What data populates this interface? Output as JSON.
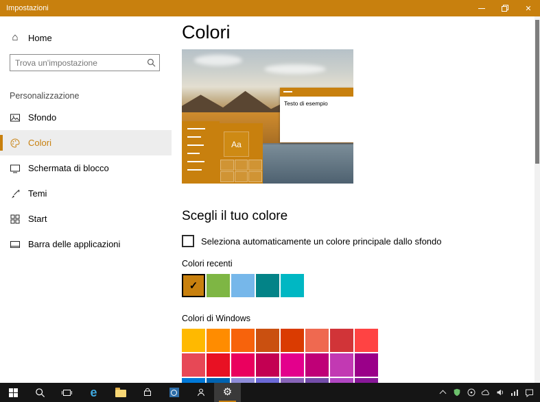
{
  "colors": {
    "accent": "#C8800E",
    "taskbar_bg": "#151515",
    "sidebar_selected_bg": "#EDEDED"
  },
  "window": {
    "title": "Impostazioni"
  },
  "icons": {
    "close": "✕",
    "check": "✓",
    "home": "⌂",
    "gear": "⚙",
    "edge": "e"
  },
  "sidebar": {
    "home": {
      "label": "Home",
      "icon": "home-icon"
    },
    "search": {
      "placeholder": "Trova un'impostazione",
      "icon": "search-icon"
    },
    "section": "Personalizzazione",
    "items": [
      {
        "label": "Sfondo",
        "icon": "background-icon",
        "selected": false
      },
      {
        "label": "Colori",
        "icon": "palette-icon",
        "selected": true
      },
      {
        "label": "Schermata di blocco",
        "icon": "lock-screen-icon",
        "selected": false
      },
      {
        "label": "Temi",
        "icon": "themes-icon",
        "selected": false
      },
      {
        "label": "Start",
        "icon": "start-grid-icon",
        "selected": false
      },
      {
        "label": "Barra delle applicazioni",
        "icon": "taskbar-icon",
        "selected": false
      }
    ]
  },
  "main": {
    "title": "Colori",
    "preview": {
      "tile_label": "Aa",
      "sample_window_text": "Testo di esempio"
    },
    "section_heading": "Scegli il tuo colore",
    "auto_color_checkbox": {
      "checked": false,
      "label": "Seleziona automaticamente un colore principale dallo sfondo"
    },
    "recent_colors": {
      "label": "Colori recenti",
      "swatches": [
        {
          "color": "#C8800E",
          "selected": true
        },
        {
          "color": "#7EB644",
          "selected": false
        },
        {
          "color": "#76B7EA",
          "selected": false
        },
        {
          "color": "#038387",
          "selected": false
        },
        {
          "color": "#00B7C3",
          "selected": false
        }
      ]
    },
    "windows_colors": {
      "label": "Colori di Windows",
      "rows": [
        [
          "#FFB900",
          "#FF8C00",
          "#F7630C",
          "#CA5010",
          "#DA3B01",
          "#EF6950",
          "#D13438",
          "#FF4343"
        ],
        [
          "#E74856",
          "#E81123",
          "#EA005E",
          "#C30052",
          "#E3008C",
          "#BF0077",
          "#C239B3",
          "#9A0089"
        ],
        [
          "#0078D7",
          "#0063B1",
          "#8E8CD8",
          "#6B69D6",
          "#8764B8",
          "#744DA9",
          "#B146C2",
          "#881798"
        ]
      ]
    }
  },
  "taskbar": {
    "apps": [
      "start",
      "search",
      "task-view",
      "edge",
      "file-explorer",
      "store",
      "photos",
      "people",
      "settings"
    ],
    "active_app": "settings",
    "tray": [
      "hidden-icons-chevron",
      "defender",
      "info",
      "onedrive",
      "volume",
      "network",
      "action-center"
    ]
  }
}
